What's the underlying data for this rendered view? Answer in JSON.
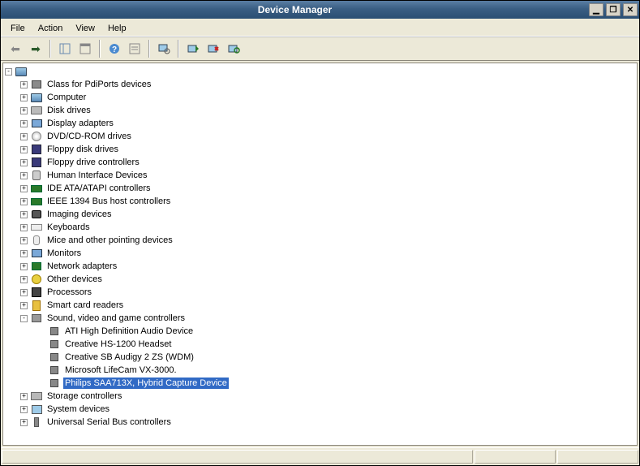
{
  "title": "Device Manager",
  "menu": {
    "file": "File",
    "action": "Action",
    "view": "View",
    "help": "Help"
  },
  "tree": {
    "root_label": "",
    "categories": [
      {
        "label": "Class for PdiPorts devices",
        "icon": "pdip",
        "expander": "+",
        "children": []
      },
      {
        "label": "Computer",
        "icon": "computer",
        "expander": "+",
        "children": []
      },
      {
        "label": "Disk drives",
        "icon": "disk",
        "expander": "+",
        "children": []
      },
      {
        "label": "Display adapters",
        "icon": "monitor",
        "expander": "+",
        "children": []
      },
      {
        "label": "DVD/CD-ROM drives",
        "icon": "cd",
        "expander": "+",
        "children": []
      },
      {
        "label": "Floppy disk drives",
        "icon": "floppy",
        "expander": "+",
        "children": []
      },
      {
        "label": "Floppy drive controllers",
        "icon": "floppy",
        "expander": "+",
        "children": []
      },
      {
        "label": "Human Interface Devices",
        "icon": "hid",
        "expander": "+",
        "children": []
      },
      {
        "label": "IDE ATA/ATAPI controllers",
        "icon": "card",
        "expander": "+",
        "children": []
      },
      {
        "label": "IEEE 1394 Bus host controllers",
        "icon": "card",
        "expander": "+",
        "children": []
      },
      {
        "label": "Imaging devices",
        "icon": "imaging",
        "expander": "+",
        "children": []
      },
      {
        "label": "Keyboards",
        "icon": "kb",
        "expander": "+",
        "children": []
      },
      {
        "label": "Mice and other pointing devices",
        "icon": "mouse",
        "expander": "+",
        "children": []
      },
      {
        "label": "Monitors",
        "icon": "monitor",
        "expander": "+",
        "children": []
      },
      {
        "label": "Network adapters",
        "icon": "net",
        "expander": "+",
        "children": []
      },
      {
        "label": "Other devices",
        "icon": "other",
        "expander": "+",
        "children": []
      },
      {
        "label": "Processors",
        "icon": "cpu",
        "expander": "+",
        "children": []
      },
      {
        "label": "Smart card readers",
        "icon": "smart",
        "expander": "+",
        "children": []
      },
      {
        "label": "Sound, video and game controllers",
        "icon": "sound",
        "expander": "-",
        "children": [
          {
            "label": "ATI High Definition Audio Device",
            "icon": "speaker",
            "selected": false
          },
          {
            "label": "Creative HS-1200 Headset",
            "icon": "speaker",
            "selected": false
          },
          {
            "label": "Creative SB Audigy 2 ZS (WDM)",
            "icon": "speaker",
            "selected": false
          },
          {
            "label": "Microsoft LifeCam VX-3000.",
            "icon": "speaker",
            "selected": false
          },
          {
            "label": "Philips SAA713X, Hybrid Capture Device",
            "icon": "speaker",
            "selected": true
          }
        ]
      },
      {
        "label": "Storage controllers",
        "icon": "storage",
        "expander": "+",
        "children": []
      },
      {
        "label": "System devices",
        "icon": "sys",
        "expander": "+",
        "children": []
      },
      {
        "label": "Universal Serial Bus controllers",
        "icon": "usb",
        "expander": "+",
        "children": []
      }
    ]
  }
}
